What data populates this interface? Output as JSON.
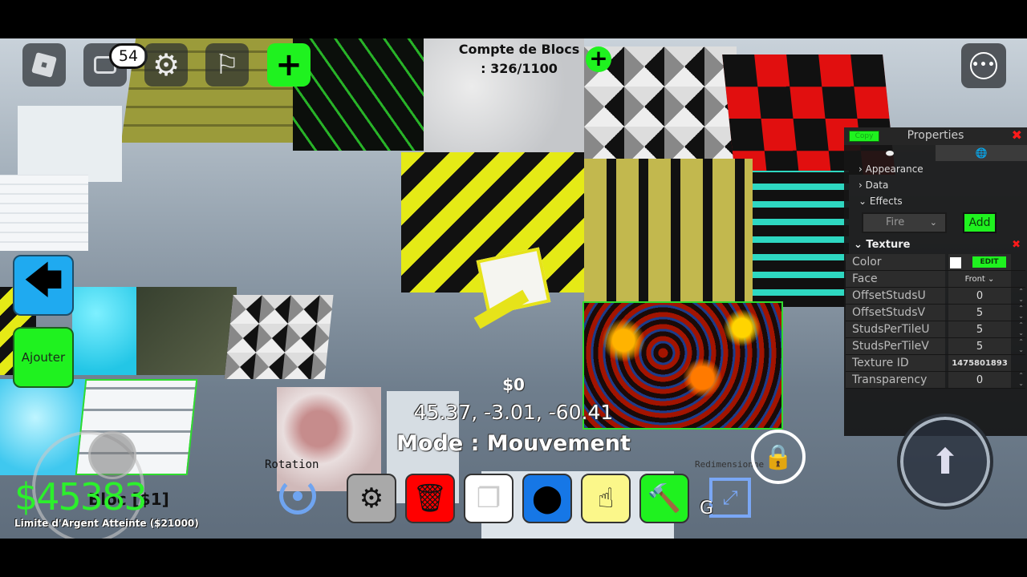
{
  "top_hud": {
    "notification_count": "54",
    "block_count_label": "Compte de Blocs",
    "block_count_value": ": 326/1100",
    "icons": {
      "roblox": "roblox-menu-icon",
      "chat": "chat-icon",
      "settings": "gear-icon",
      "flag": "flag-icon",
      "add": "plus-icon",
      "more": "more-icon"
    },
    "add_symbol": "+",
    "block_add_symbol": "+",
    "more_symbol": "•••",
    "gear_symbol": "⚙",
    "flag_symbol": "⚐"
  },
  "left_buttons": {
    "back_symbol": "🡄",
    "add_label": "Ajouter"
  },
  "properties": {
    "copy_label": "Copy",
    "title": "Properties",
    "close_symbol": "✖",
    "tabs": [
      {
        "icon": "part-icon",
        "symbol": "⬬"
      },
      {
        "icon": "globe-icon",
        "symbol": "🌐"
      }
    ],
    "sections": [
      {
        "label": "Appearance",
        "expanded": false,
        "chevron": "›"
      },
      {
        "label": "Data",
        "expanded": false,
        "chevron": "›"
      },
      {
        "label": "Effects",
        "expanded": true,
        "chevron": "⌄"
      }
    ],
    "effect_select_value": "Fire",
    "effect_add_label": "Add",
    "texture_header": "Texture",
    "texture_delete_symbol": "✖",
    "rows": [
      {
        "name": "Color",
        "value": "",
        "edit_label": "EDIT",
        "color": "#ffffff"
      },
      {
        "name": "Face",
        "value": "Front"
      },
      {
        "name": "OffsetStudsU",
        "value": "0"
      },
      {
        "name": "OffsetStudsV",
        "value": "5"
      },
      {
        "name": "StudsPerTileU",
        "value": "5"
      },
      {
        "name": "StudsPerTileV",
        "value": "5"
      },
      {
        "name": "Texture ID",
        "value": "1475801893"
      },
      {
        "name": "Transparency",
        "value": "0"
      }
    ]
  },
  "center": {
    "cost": "$0",
    "coordinates": "45.37, -3.01, -60.41",
    "mode": "Mode : Mouvement"
  },
  "bottom_left": {
    "money": "$45383",
    "selected_block": "Bloc [$1]",
    "limit_text": "Limite d'Argent Atteinte ($21000)"
  },
  "toolbar": {
    "rotation_label": "Rotation",
    "resize_label": "Redimensionne",
    "resize_key": "G",
    "tools": [
      {
        "name": "settings",
        "icon": "gear-icon",
        "symbol": "⚙",
        "color": "#a9a9a9"
      },
      {
        "name": "delete",
        "icon": "trash-icon",
        "symbol": "🗑",
        "color": "#ff0000"
      },
      {
        "name": "copy",
        "icon": "copy-icon",
        "symbol": "❐",
        "color": "#ffffff"
      },
      {
        "name": "move",
        "icon": "location-pin-icon",
        "symbol": "⬤",
        "color": "#1677e6"
      },
      {
        "name": "select",
        "icon": "pointer-hand-icon",
        "symbol": "☝",
        "color": "#fbf78a"
      },
      {
        "name": "build",
        "icon": "hammer-icon",
        "symbol": "🔨",
        "color": "#1ff21f"
      }
    ],
    "resize_symbol": "⤢",
    "lock_symbol": "🔒",
    "jump_symbol": "⬆"
  },
  "colors": {
    "accent_green": "#1ff21f",
    "money_green": "#2cf02c",
    "close_red": "#ff1a1a",
    "back_blue": "#1faaf0"
  }
}
